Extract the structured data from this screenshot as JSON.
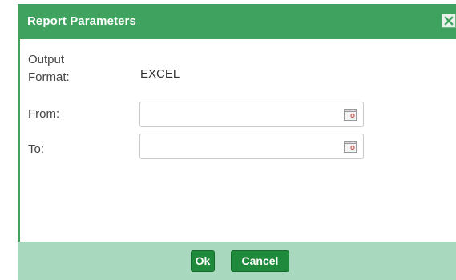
{
  "dialog": {
    "title": "Report Parameters",
    "close_icon": "close-x-icon"
  },
  "form": {
    "output_format_label_line1": "Output",
    "output_format_label_line2": "Format:",
    "output_format_value": "EXCEL",
    "from_label": "From:",
    "from_value": "",
    "to_label": "To:",
    "to_value": "",
    "calendar_icon": "calendar-icon"
  },
  "buttons": {
    "ok_label": "Ok",
    "cancel_label": "Cancel"
  },
  "colors": {
    "titlebar": "#3fa35f",
    "footer": "#a8d9be",
    "button": "#1f8a3b"
  }
}
